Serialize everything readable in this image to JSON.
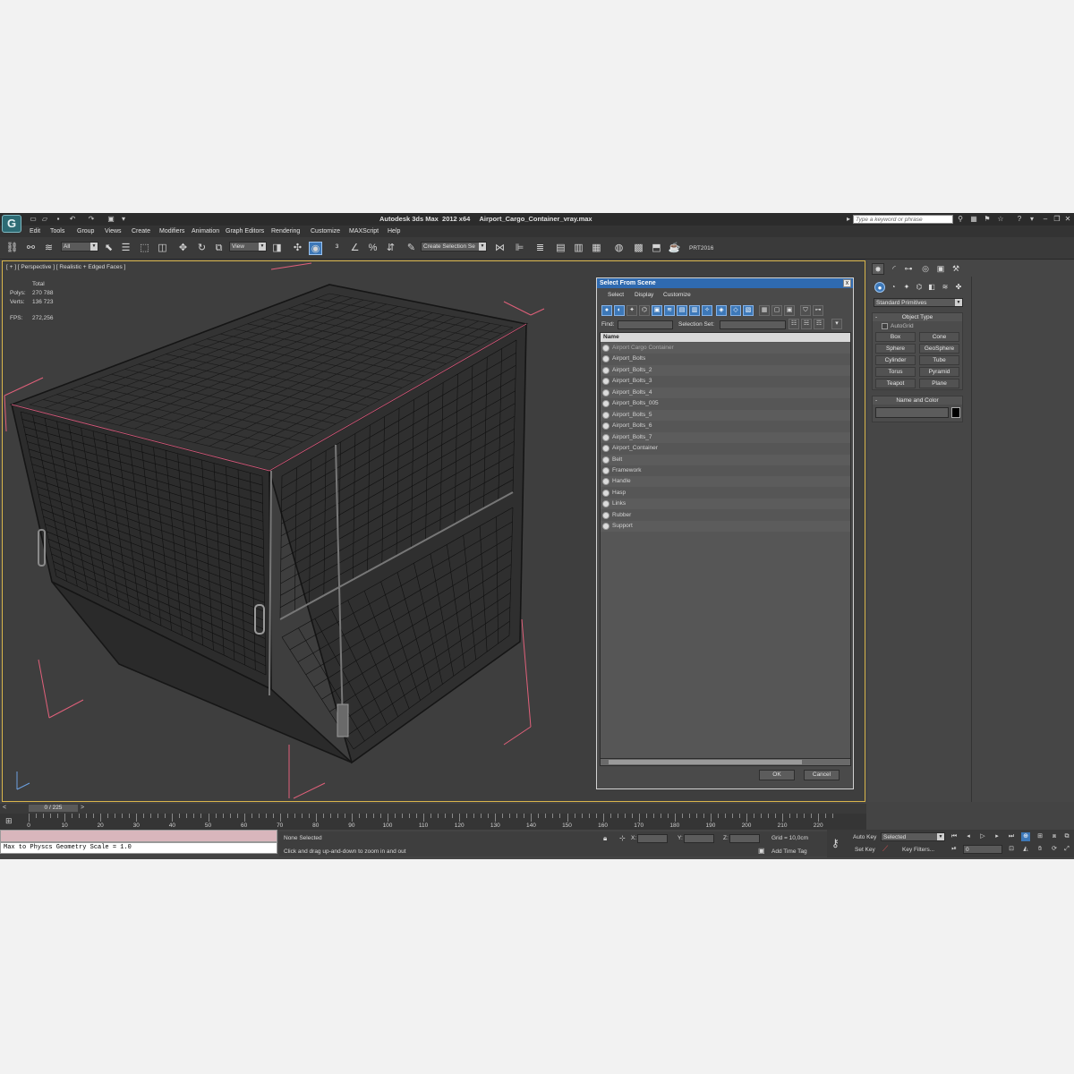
{
  "app": {
    "title": "Autodesk 3ds Max  2012 x64     Airport_Cargo_Container_vray.max",
    "logo": "G",
    "search_placeholder": "Type a keyword or phrase"
  },
  "menu": [
    "Edit",
    "Tools",
    "Group",
    "Views",
    "Create",
    "Modifiers",
    "Animation",
    "Graph Editors",
    "Rendering",
    "Customize",
    "MAXScript",
    "Help"
  ],
  "toolbar": {
    "selection_filter": "All",
    "ref_coord": "View",
    "named_selection": "Create Selection Se",
    "plugin_label": "PRT2016"
  },
  "viewport": {
    "label": "[ + ] [ Perspective ] [ Realistic + Edged Faces ]",
    "stats": {
      "header": "Total",
      "rows": [
        {
          "key": "Polys:",
          "value": "270 788"
        },
        {
          "key": "Verts:",
          "value": "136 723"
        }
      ],
      "fps_key": "FPS:",
      "fps_value": "272,256"
    },
    "axis_x": "x",
    "axis_z": "z"
  },
  "dialog": {
    "title": "Select From Scene",
    "close": "x",
    "menu": [
      "Select",
      "Display",
      "Customize"
    ],
    "find_label": "Find:",
    "selection_set_label": "Selection Set:",
    "column_header": "Name",
    "items": [
      "Airport Cargo Container",
      "Airport_Bolts",
      "Airport_Bolts_2",
      "Airport_Bolts_3",
      "Airport_Bolts_4",
      "Airport_Bolts_005",
      "Airport_Bolts_5",
      "Airport_Bolts_6",
      "Airport_Bolts_7",
      "Airport_Container",
      "Belt",
      "Framework",
      "Handle",
      "Hasp",
      "Links",
      "Rubber",
      "Support"
    ],
    "ok": "OK",
    "cancel": "Cancel"
  },
  "command_panel": {
    "category": "Standard Primitives",
    "object_type_title": "Object Type",
    "autogrid": "AutoGrid",
    "primitives": [
      "Box",
      "Cone",
      "Sphere",
      "GeoSphere",
      "Cylinder",
      "Tube",
      "Torus",
      "Pyramid",
      "Teapot",
      "Plane"
    ],
    "name_color_title": "Name and Color",
    "minus": "-"
  },
  "timeline": {
    "frame": "0 / 225",
    "prev": "<",
    "next": ">",
    "ticks": [
      "0",
      "10",
      "20",
      "30",
      "40",
      "50",
      "60",
      "70",
      "80",
      "90",
      "100",
      "110",
      "120",
      "130",
      "140",
      "150",
      "160",
      "170",
      "180",
      "190",
      "200",
      "210",
      "220"
    ]
  },
  "status": {
    "maxscript_output": "Max to Physcs Geometry Scale = 1.0",
    "selection": "None Selected",
    "prompt": "Click and drag up-and-down to zoom in and out",
    "x_label": "X:",
    "y_label": "Y:",
    "z_label": "Z:",
    "grid": "Grid = 10,0cm",
    "add_time_tag": "Add Time Tag",
    "auto_key": "Auto Key",
    "set_key": "Set Key",
    "key_mode": "Selected",
    "key_filters": "Key Filters...",
    "current_frame": "0"
  },
  "colors": {
    "accent": "#3d78b8",
    "viewport_border": "#d9b54b",
    "stats_text": "#e3c54a",
    "bbox_brackets": "#e0607a",
    "maxscript_listener": "#d9b6bc"
  }
}
